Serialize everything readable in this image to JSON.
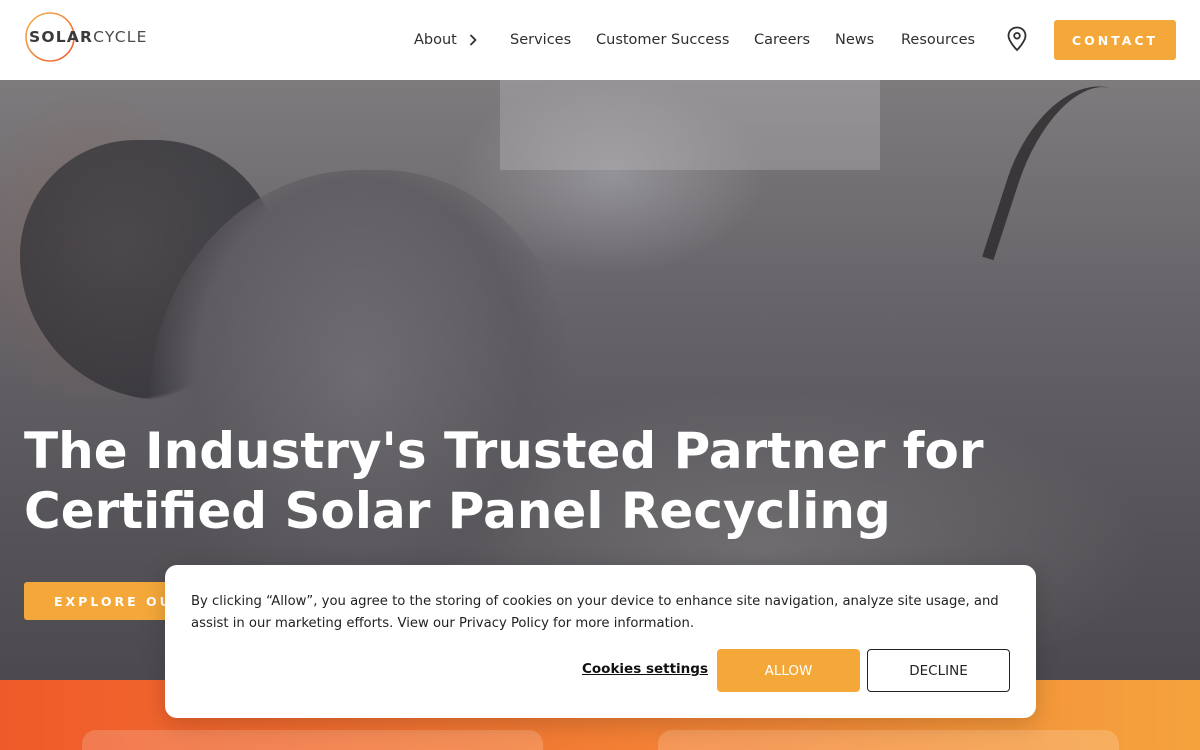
{
  "brand": {
    "logo_solar": "SOLAR",
    "logo_cycle": "CYCLE",
    "accent_color": "#f5a83a",
    "ring_gradient": [
      "#f5a83a",
      "#ef5a2a"
    ]
  },
  "nav": {
    "about": "About",
    "about_icon": "chevron-right-icon",
    "services": "Services",
    "customer_success": "Customer Success",
    "careers": "Careers",
    "news": "News",
    "resources": "Resources",
    "location_icon": "map-pin-icon",
    "contact": "CONTACT"
  },
  "hero": {
    "title_line1": "The Industry's Trusted Partner for",
    "title_line2": "Certified Solar Panel Recycling",
    "cta": "EXPLORE OUR SERVICES"
  },
  "cookie_banner": {
    "text": "By clicking “Allow”, you agree to the storing of cookies on your device to enhance site navigation, analyze site usage, and assist in our marketing efforts. View our Privacy Policy for more information.",
    "settings_label": "Cookies settings",
    "allow_label": "ALLOW",
    "decline_label": "DECLINE"
  }
}
